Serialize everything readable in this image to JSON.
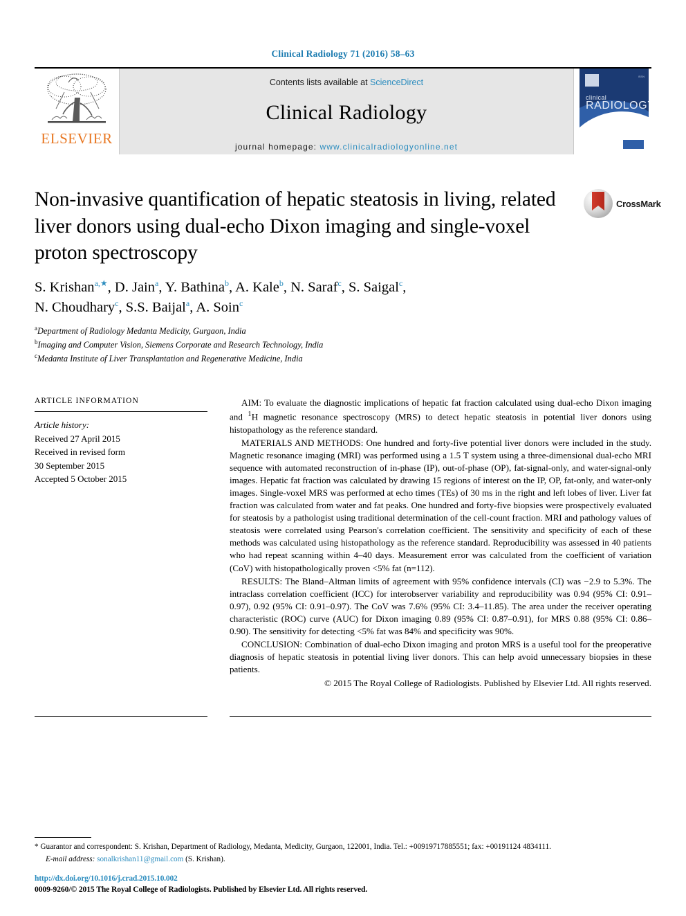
{
  "running_head": "Clinical Radiology 71 (2016) 58–63",
  "masthead": {
    "publisher_logo_text": "ELSEVIER",
    "contents_prefix": "Contents lists available at ",
    "contents_link": "ScienceDirect",
    "journal_name": "Clinical Radiology",
    "homepage_prefix": "journal homepage: ",
    "homepage_url": "www.clinicalradiologyonline.net",
    "cover": {
      "line1": "clinical",
      "line2": "RADIOLOGY",
      "issn_corner": "ISSN"
    }
  },
  "article": {
    "title": "Non-invasive quantification of hepatic steatosis in living, related liver donors using dual-echo Dixon imaging and single-voxel proton spectroscopy",
    "crossmark_label": "CrossMark",
    "authors_line1": "S. Krishan a,*, D. Jain a, Y. Bathina b, A. Kale b, N. Saraf c, S. Saigal c,",
    "authors_line2": "N. Choudhary c, S.S. Baijal a, A. Soin c",
    "authors": [
      {
        "name": "S. Krishan",
        "marks": "a,*"
      },
      {
        "name": "D. Jain",
        "marks": "a"
      },
      {
        "name": "Y. Bathina",
        "marks": "b"
      },
      {
        "name": "A. Kale",
        "marks": "b"
      },
      {
        "name": "N. Saraf",
        "marks": "c"
      },
      {
        "name": "S. Saigal",
        "marks": "c"
      },
      {
        "name": "N. Choudhary",
        "marks": "c"
      },
      {
        "name": "S.S. Baijal",
        "marks": "a"
      },
      {
        "name": "A. Soin",
        "marks": "c"
      }
    ],
    "affiliations": [
      {
        "mark": "a",
        "text": "Department of Radiology Medanta Medicity, Gurgaon, India"
      },
      {
        "mark": "b",
        "text": "Imaging and Computer Vision, Siemens Corporate and Research Technology, India"
      },
      {
        "mark": "c",
        "text": "Medanta Institute of Liver Transplantation and Regenerative Medicine, India"
      }
    ]
  },
  "article_information": {
    "heading": "article information",
    "history_label": "Article history:",
    "history": [
      "Received 27 April 2015",
      "Received in revised form",
      "30 September 2015",
      "Accepted 5 October 2015"
    ]
  },
  "abstract": {
    "aim": "AIM: To evaluate the diagnostic implications of hepatic fat fraction calculated using dual-echo Dixon imaging and 1H magnetic resonance spectroscopy (MRS) to detect hepatic steatosis in potential liver donors using histopathology as the reference standard.",
    "materials_and_methods": "MATERIALS AND METHODS: One hundred and forty-five potential liver donors were included in the study. Magnetic resonance imaging (MRI) was performed using a 1.5 T system using a three-dimensional dual-echo MRI sequence with automated reconstruction of in-phase (IP), out-of-phase (OP), fat-signal-only, and water-signal-only images. Hepatic fat fraction was calculated by drawing 15 regions of interest on the IP, OP, fat-only, and water-only images. Single-voxel MRS was performed at echo times (TEs) of 30 ms in the right and left lobes of liver. Liver fat fraction was calculated from water and fat peaks. One hundred and forty-five biopsies were prospectively evaluated for steatosis by a pathologist using traditional determination of the cell-count fraction. MRI and pathology values of steatosis were correlated using Pearson's correlation coefficient. The sensitivity and specificity of each of these methods was calculated using histopathology as the reference standard. Reproducibility was assessed in 40 patients who had repeat scanning within 4–40 days. Measurement error was calculated from the coefficient of variation (CoV) with histopathologically proven <5% fat (n=112).",
    "results": "RESULTS: The Bland–Altman limits of agreement with 95% confidence intervals (CI) was −2.9 to 5.3%. The intraclass correlation coefficient (ICC) for interobserver variability and reproducibility was 0.94 (95% CI: 0.91–0.97), 0.92 (95% CI: 0.91–0.97). The CoV was 7.6% (95% CI: 3.4–11.85). The area under the receiver operating characteristic (ROC) curve (AUC) for Dixon imaging 0.89 (95% CI: 0.87–0.91), for MRS 0.88 (95% CI: 0.86–0.90). The sensitivity for detecting <5% fat was 84% and specificity was 90%.",
    "conclusion": "CONCLUSION: Combination of dual-echo Dixon imaging and proton MRS is a useful tool for the preoperative diagnosis of hepatic steatosis in potential living liver donors. This can help avoid unnecessary biopsies in these patients.",
    "copyright": "© 2015 The Royal College of Radiologists. Published by Elsevier Ltd. All rights reserved."
  },
  "footnotes": {
    "correspondence": "* Guarantor and correspondent: S. Krishan, Department of Radiology, Medanta, Medicity, Gurgaon, 122001, India. Tel.: +00919717885551; fax: +00191124 4834111.",
    "email_label": "E-mail address: ",
    "email_address": "sonalkrishan11@gmail.com",
    "email_suffix": " (S. Krishan)."
  },
  "footer": {
    "doi": "http://dx.doi.org/10.1016/j.crad.2015.10.002",
    "issn_line": "0009-9260/© 2015 The Royal College of Radiologists. Published by Elsevier Ltd. All rights reserved."
  },
  "colors": {
    "link": "#2b8cbe",
    "running_head": "#1b7bb0",
    "elsevier_orange": "#E87722",
    "cover_blue": "#1b3a73",
    "crossmark_red": "#b5291c"
  }
}
